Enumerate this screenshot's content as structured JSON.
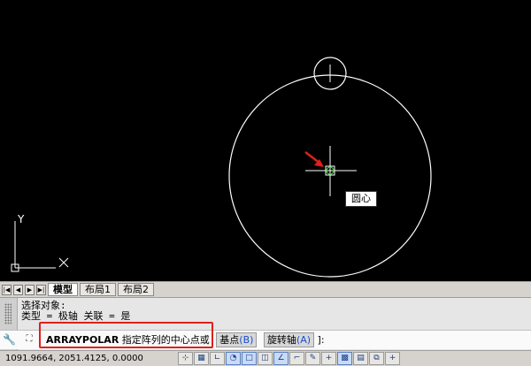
{
  "canvas": {
    "background": "#000000",
    "snap_tooltip": "圆心",
    "ucs_label": "Y"
  },
  "tabs": {
    "nav_buttons": [
      "first-icon",
      "prev-icon",
      "next-icon",
      "last-icon"
    ],
    "items": [
      {
        "label": "模型",
        "active": true
      },
      {
        "label": "布局1",
        "active": false
      },
      {
        "label": "布局2",
        "active": false
      }
    ]
  },
  "command": {
    "history_line1": "选择对象:",
    "history_line2": "类型 = 极轴  关联 = 是",
    "command_name": "ARRAYPOLAR",
    "prompt": "指定阵列的中心点或",
    "option1": {
      "label": "基点",
      "key": "(B)"
    },
    "option2": {
      "label": "旋转轴",
      "key": "(A)"
    },
    "tail": "]:",
    "highlight_color": "#e0201a"
  },
  "status": {
    "coordinates": "1091.9664, 2051.4125, 0.0000",
    "buttons": [
      "snap",
      "grid",
      "ortho",
      "polar",
      "osnap",
      "3dosnap",
      "otrack",
      "ducs",
      "dyn",
      "lwt",
      "tpy",
      "qp",
      "sc",
      "am"
    ]
  }
}
